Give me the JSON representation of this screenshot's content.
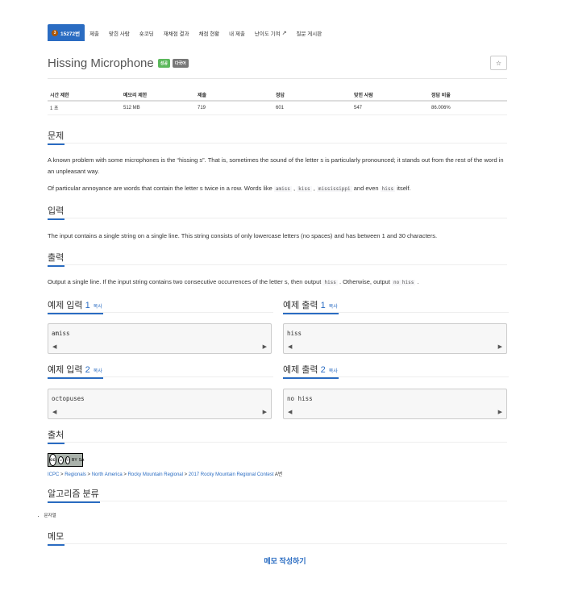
{
  "tabs": {
    "problem_tier": "3",
    "problem_number": "15272번",
    "submit": "제출",
    "my_submissions": "맞힌 사람",
    "shortest_code": "숏코딩",
    "rejudge_results": "재채점 결과",
    "rejudge_status": "채점 현황",
    "my_submit": "내 제출",
    "difficulty_contrib": "난이도 기여",
    "board": "질문 게시판"
  },
  "problem": {
    "title": "Hissing Microphone",
    "badge_success": "성공",
    "badge_multilang": "다국어",
    "star": "☆"
  },
  "info_table": {
    "headers": [
      "시간 제한",
      "메모리 제한",
      "제출",
      "정답",
      "맞힌 사람",
      "정답 비율"
    ],
    "values": [
      "1 초",
      "512 MB",
      "719",
      "601",
      "547",
      "86.006%"
    ]
  },
  "sections": {
    "description": "문제",
    "input": "입력",
    "output": "출력",
    "sample_input_1": "예제 입력",
    "sample_output_1": "예제 출력",
    "sample_input_2": "예제 입력",
    "sample_output_2": "예제 출력",
    "num1": "1",
    "num2": "2",
    "copy": "복사",
    "source": "출처",
    "algorithm": "알고리즘 분류",
    "memo": "메모"
  },
  "description": {
    "p1": "A known problem with some microphones is the “hissing s”. That is, sometimes the sound of the letter s is particularly pronounced; it stands out from the rest of the word in an unpleasant way.",
    "p2_a": "Of particular annoyance are words that contain the letter s twice in a row. Words like ",
    "p2_c1": "amiss",
    "p2_sep1": " , ",
    "p2_c2": "kiss",
    "p2_sep2": " , ",
    "p2_c3": "mississippi",
    "p2_b": " and even ",
    "p2_c4": "hiss",
    "p2_end": " itself."
  },
  "input_text": "The input contains a single string on a single line. This string consists of only lowercase letters (no spaces) and has between 1 and 30 characters.",
  "output_text": {
    "a": "Output a single line. If the input string contains two consecutive occurrences of the letter s, then output ",
    "c1": "hiss",
    "b": " . Otherwise, output ",
    "c2": "no hiss",
    "end": " ."
  },
  "samples": {
    "in1": "amiss",
    "out1": "hiss",
    "in2": "octopuses",
    "out2": "no hiss",
    "arrow_left": "◀",
    "arrow_right": "▶"
  },
  "license": {
    "cc": "cc",
    "by": "BY",
    "sa": "SA"
  },
  "breadcrumb": {
    "icpc": "ICPC",
    "sep": " > ",
    "regionals": "Regionals",
    "na": "North America",
    "rm": "Rocky Mountain Regional",
    "contest": "2017 Rocky Mountain Regional Contest",
    "letter": " A번"
  },
  "algorithm_tags": [
    "문자열"
  ],
  "memo_button": "메모 작성하기"
}
